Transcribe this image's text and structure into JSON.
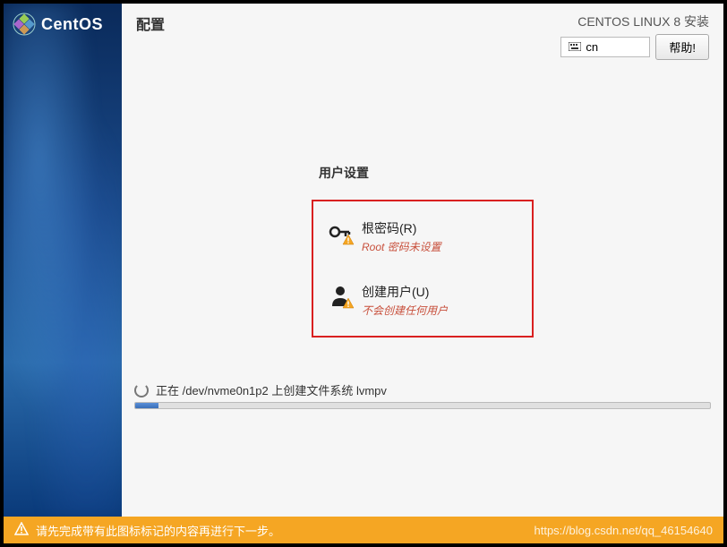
{
  "brand": {
    "name": "CentOS"
  },
  "page": {
    "title": "配置",
    "install_title": "CENTOS LINUX 8 安装",
    "layout_code": "cn",
    "help_label": "帮助!"
  },
  "user_settings": {
    "heading": "用户设置",
    "root_password": {
      "title": "根密码(R)",
      "status": "Root 密码未设置"
    },
    "create_user": {
      "title": "创建用户(U)",
      "status": "不会创建任何用户"
    }
  },
  "progress": {
    "text": "正在 /dev/nvme0n1p2 上创建文件系统 lvmpv",
    "percent": 4
  },
  "footer": {
    "warning": "请先完成带有此图标标记的内容再进行下一步。",
    "watermark": "https://blog.csdn.net/qq_46154640"
  }
}
